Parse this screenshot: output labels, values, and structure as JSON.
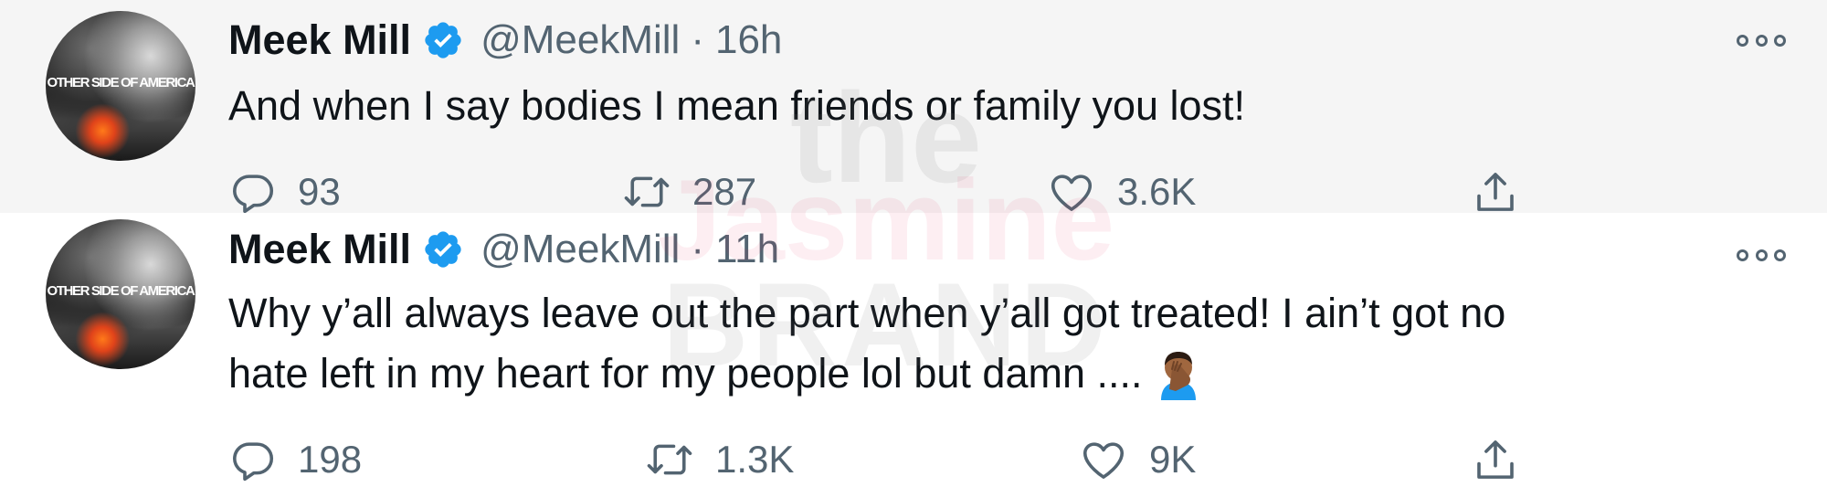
{
  "tweets": [
    {
      "author_name": "Meek Mill",
      "handle": "@MeekMill",
      "separator": "·",
      "time": "16h",
      "text_lines": [
        "And when I say bodies I mean friends or family you lost!"
      ],
      "stats": {
        "replies": "93",
        "retweets": "287",
        "likes": "3.6K"
      },
      "avatar_text": "OTHER SIDE OF AMERICA"
    },
    {
      "author_name": "Meek Mill",
      "handle": "@MeekMill",
      "separator": "·",
      "time": "11h",
      "text_lines": [
        "Why y’all always leave out the part when y’all got treated! I ain’t got no",
        "hate left in my heart for my people lol but damn ...."
      ],
      "emoji": "man-facepalming-emoji",
      "stats": {
        "replies": "198",
        "retweets": "1.3K",
        "likes": "9K"
      },
      "avatar_text": "OTHER SIDE OF AMERICA"
    }
  ],
  "watermark": [
    "the",
    "Jasmine",
    "BRAND"
  ],
  "icons": {
    "verified": "verified-badge-icon",
    "more": "more-options-icon",
    "reply": "reply-icon",
    "retweet": "retweet-icon",
    "like": "like-icon",
    "share": "share-icon"
  },
  "colors": {
    "verified_blue": "#1d9bf0",
    "text": "#0f1419",
    "secondary": "#536471",
    "highlight_bg": "#f5f5f5"
  }
}
